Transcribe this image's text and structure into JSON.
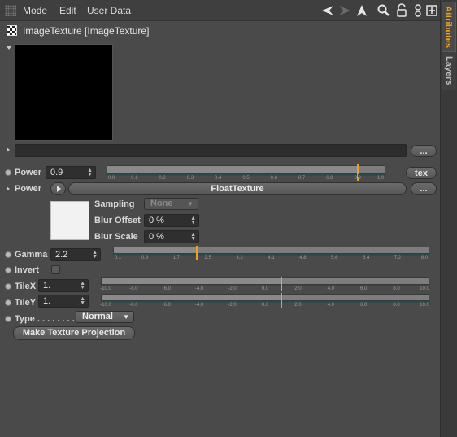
{
  "menubar": {
    "items": [
      "Mode",
      "Edit",
      "User Data"
    ]
  },
  "toolbar_icons": [
    "back-arrow-icon",
    "forward-arrow-icon",
    "cursor-icon",
    "search-icon",
    "lock-icon",
    "link-icon",
    "new-window-icon"
  ],
  "side_tabs": {
    "attributes": "Attributes",
    "layers": "Layers"
  },
  "header": {
    "title": "ImageTexture [ImageTexture]"
  },
  "preview": {
    "more_button": "..."
  },
  "power": {
    "label": "Power",
    "value": "0.9",
    "button": "tex",
    "slider": {
      "min": 0.0,
      "max": 1.0,
      "value": 0.9,
      "ticks": [
        "0.0",
        "0.1",
        "0.2",
        "0.3",
        "0.4",
        "0.5",
        "0.6",
        "0.7",
        "0.8",
        "0.9",
        "1.0"
      ]
    }
  },
  "power_texture": {
    "label": "Power",
    "texture_button": "FloatTexture",
    "more_button": "...",
    "sampling_label": "Sampling",
    "sampling_value": "None",
    "blur_offset_label": "Blur Offset",
    "blur_offset_value": "0 %",
    "blur_scale_label": "Blur Scale",
    "blur_scale_value": "0 %"
  },
  "gamma": {
    "label": "Gamma",
    "value": "2.2",
    "slider": {
      "min": 0.1,
      "max": 8.0,
      "value": 2.2,
      "ticks": [
        "0.1",
        "0.9",
        "1.7",
        "2.5",
        "3.3",
        "4.1",
        "4.8",
        "5.6",
        "6.4",
        "7.2",
        "8.0"
      ]
    }
  },
  "invert": {
    "label": "Invert"
  },
  "tilex": {
    "label": "TileX",
    "value": "1.",
    "slider": {
      "min": -10.0,
      "max": 10.0,
      "value": 1.0,
      "ticks": [
        "-10.0",
        "-8.0",
        "-6.0",
        "-4.0",
        "-2.0",
        "0.0",
        "2.0",
        "4.0",
        "6.0",
        "8.0",
        "10.0"
      ]
    }
  },
  "tiley": {
    "label": "TileY",
    "value": "1.",
    "slider": {
      "min": -10.0,
      "max": 10.0,
      "value": 1.0,
      "ticks": [
        "-10.0",
        "-8.0",
        "-6.0",
        "-4.0",
        "-2.0",
        "0.0",
        "2.0",
        "4.0",
        "6.0",
        "8.0",
        "10.0"
      ]
    }
  },
  "type": {
    "label": "Type . . . . . . . .",
    "value": "Normal"
  },
  "make_projection_button": "Make Texture Projection",
  "colors": {
    "accent": "#f0a020",
    "panel": "#4a4a4a",
    "field": "#2f2f2f"
  }
}
